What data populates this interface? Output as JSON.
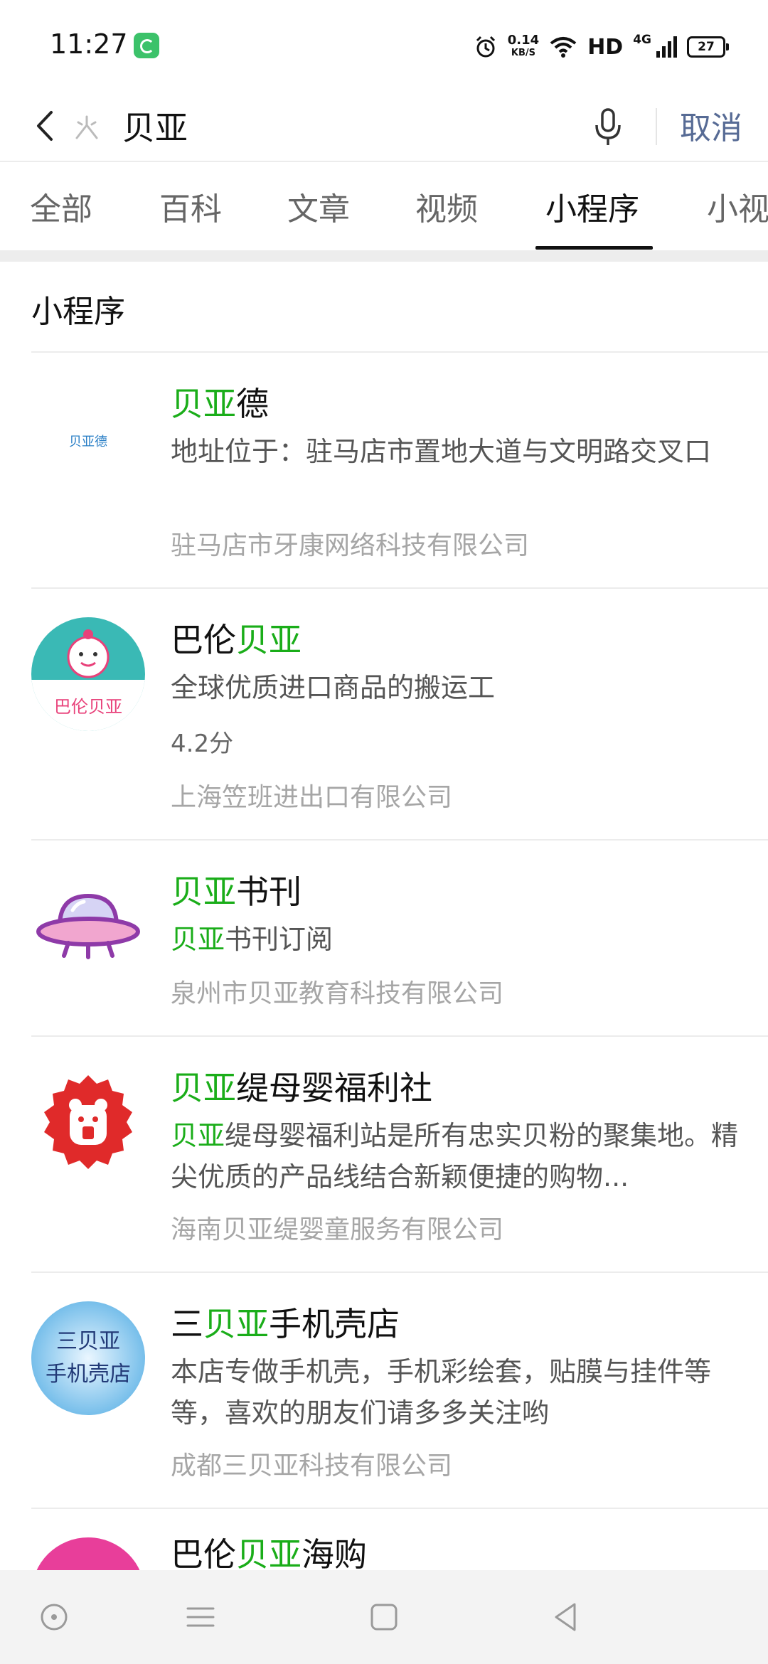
{
  "status_bar": {
    "time": "11:27",
    "net_speed_value": "0.14",
    "net_speed_unit": "KB/S",
    "hd": "HD",
    "signal": "4G",
    "battery": "27"
  },
  "search": {
    "query": "贝亚",
    "cancel_label": "取消"
  },
  "tabs": [
    {
      "label": "全部"
    },
    {
      "label": "百科"
    },
    {
      "label": "文章"
    },
    {
      "label": "视频"
    },
    {
      "label": "小程序",
      "active": true
    },
    {
      "label": "小视"
    }
  ],
  "section": {
    "title": "小程序"
  },
  "results": [
    {
      "title_pre": "",
      "title_hl": "贝亚",
      "title_post": "德",
      "logo_text": "贝亚德",
      "desc": "地址位于：驻马店市置地大道与文明路交叉口",
      "company": "驻马店市牙康网络科技有限公司"
    },
    {
      "title_pre": "巴伦",
      "title_hl": "贝亚",
      "title_post": "",
      "logo_text": "巴伦贝亚",
      "desc": "全球优质进口商品的搬运工",
      "rating": "4.2分",
      "company": "上海笠班进出口有限公司"
    },
    {
      "title_pre": "",
      "title_hl": "贝亚",
      "title_post": "书刊",
      "desc_hl": "贝亚",
      "desc_post": "书刊订阅",
      "company": "泉州市贝亚教育科技有限公司"
    },
    {
      "title_pre": "",
      "title_hl": "贝亚",
      "title_post": "缇母婴福利社",
      "desc_hl": "贝亚",
      "desc_post": "缇母婴福利站是所有忠实贝粉的聚集地。精尖优质的产品线结合新颖便捷的购物...",
      "company": "海南贝亚缇婴童服务有限公司"
    },
    {
      "title_pre": "三",
      "title_hl": "贝亚",
      "title_post": "手机壳店",
      "logo_line1": "三贝亚",
      "logo_line2": "手机壳店",
      "desc": "本店专做手机壳，手机彩绘套，贴膜与挂件等等，喜欢的朋友们请多多关注哟",
      "company": "成都三贝亚科技有限公司"
    },
    {
      "title_pre": "巴伦",
      "title_hl": "贝亚",
      "title_post": "海购"
    }
  ],
  "colors": {
    "highlight": "#1aad19",
    "cancel": "#576b95"
  }
}
